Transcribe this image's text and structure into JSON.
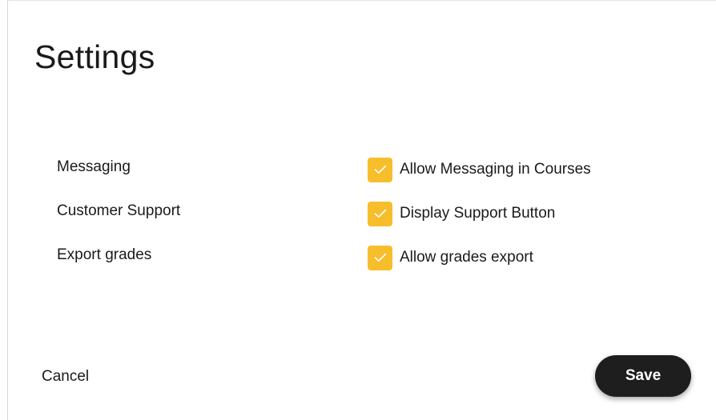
{
  "title": "Settings",
  "colors": {
    "checkbox": "#f7be2c",
    "save_button": "#1e1e1e"
  },
  "settings": [
    {
      "label": "Messaging",
      "option": "Allow Messaging in Courses",
      "checked": true,
      "icon": "checkmark-icon"
    },
    {
      "label": "Customer Support",
      "option": "Display Support Button",
      "checked": true,
      "icon": "checkmark-icon"
    },
    {
      "label": "Export grades",
      "option": "Allow grades export",
      "checked": true,
      "icon": "checkmark-icon"
    }
  ],
  "actions": {
    "cancel_label": "Cancel",
    "save_label": "Save"
  }
}
